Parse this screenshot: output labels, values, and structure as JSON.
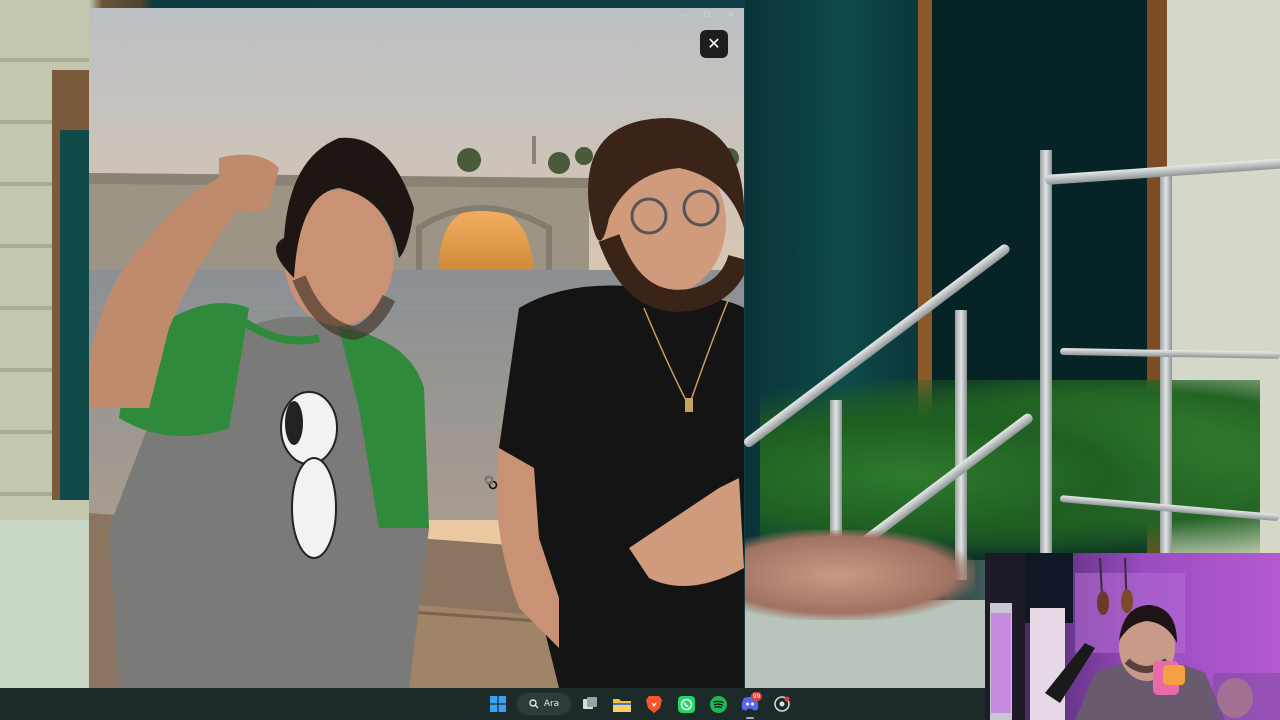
{
  "viewer": {
    "close_label": "✕"
  },
  "taskbar": {
    "search_label": "Ara",
    "apps": [
      {
        "name": "start",
        "icon": "windows-logo-icon"
      },
      {
        "name": "task-view",
        "icon": "task-view-icon"
      },
      {
        "name": "file-explorer",
        "icon": "folder-icon"
      },
      {
        "name": "brave",
        "icon": "brave-lion-icon"
      },
      {
        "name": "whatsapp",
        "icon": "whatsapp-icon"
      },
      {
        "name": "spotify",
        "icon": "spotify-icon"
      },
      {
        "name": "discord",
        "icon": "discord-icon",
        "badge": "99"
      },
      {
        "name": "obs-or-app",
        "icon": "app-icon"
      }
    ]
  },
  "colors": {
    "taskbar_bg": "#1d2a2a",
    "spotify": "#1db954",
    "whatsapp": "#25d366",
    "discord": "#5865f2",
    "badge": "#e23d3d"
  }
}
